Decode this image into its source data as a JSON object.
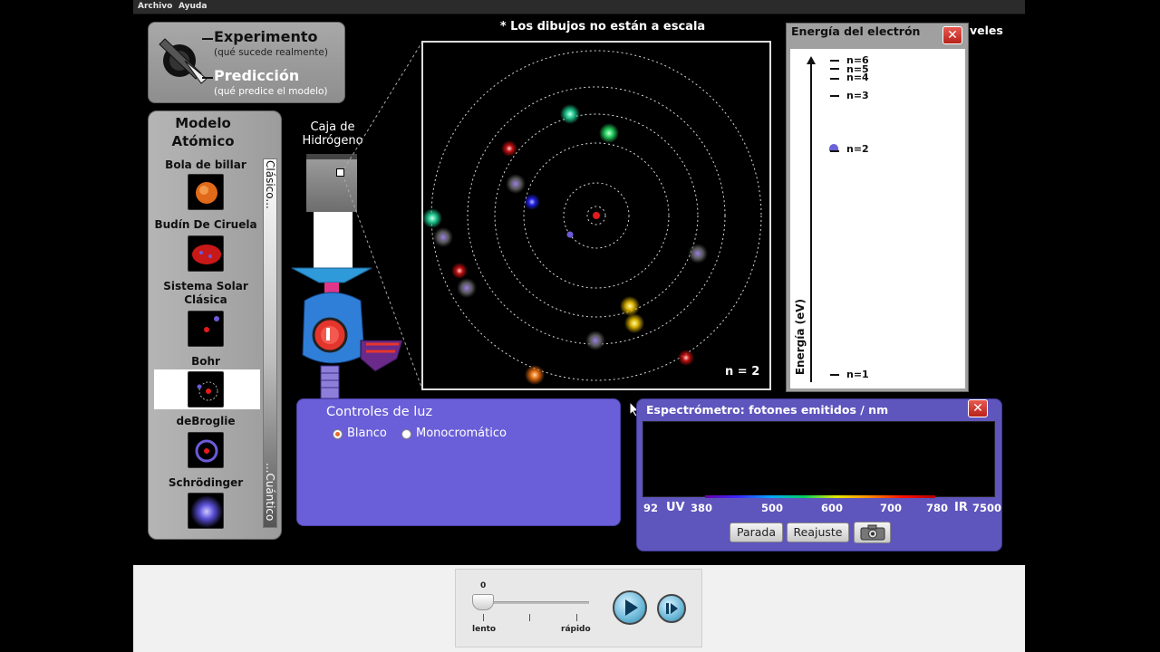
{
  "menu": [
    "Archivo",
    "Ayuda"
  ],
  "mode": {
    "experiment_title": "Experimento",
    "experiment_sub": "(qué sucede realmente)",
    "prediction_title": "Predicción",
    "prediction_sub": "(qué predice el modelo)"
  },
  "model_panel": {
    "heading_1": "Modelo",
    "heading_2": "Atómico",
    "scale_top": "Clásico...",
    "scale_bottom": "...Cuántico",
    "models": [
      {
        "label": "Bola de billar",
        "icon": "billiard-ball-icon"
      },
      {
        "label": "Budín De Ciruela",
        "icon": "plum-pudding-icon"
      },
      {
        "label": "Sistema Solar Clásica",
        "icon": "solar-system-icon"
      },
      {
        "label": "Bohr",
        "icon": "bohr-icon",
        "selected": true
      },
      {
        "label": "deBroglie",
        "icon": "debroglie-icon"
      },
      {
        "label": "Schrödinger",
        "icon": "schrodinger-icon"
      }
    ]
  },
  "box": {
    "label_1": "Caja de",
    "label_2": "Hidrógeno"
  },
  "atom": {
    "caption": "* Los dibujos no están a escala",
    "state": "n = 2"
  },
  "energy": {
    "title": "Energía del electrón",
    "clipped_text": "veles",
    "axis_label": "Energía (eV)",
    "levels": [
      "n=6",
      "n=5",
      "n=4",
      "n=3",
      "n=2",
      "n=1"
    ]
  },
  "light": {
    "title": "Controles de luz",
    "option_white": "Blanco",
    "option_mono": "Monocromático",
    "selected": "Blanco"
  },
  "spectrometer": {
    "title": "Espectrómetro: fotones emitidos / nm",
    "ticks": [
      "92",
      "380",
      "500",
      "600",
      "700",
      "780",
      "7500"
    ],
    "uv": "UV",
    "ir": "IR",
    "stop_label": "Parada",
    "reset_label": "Reajuste"
  },
  "clock": {
    "value": "0",
    "slow": "lento",
    "fast": "rápido"
  },
  "colors": {
    "panel_purple": "#6a5fd8",
    "spectrometer_purple": "#5e55bd",
    "close_red": "#c8352c"
  }
}
